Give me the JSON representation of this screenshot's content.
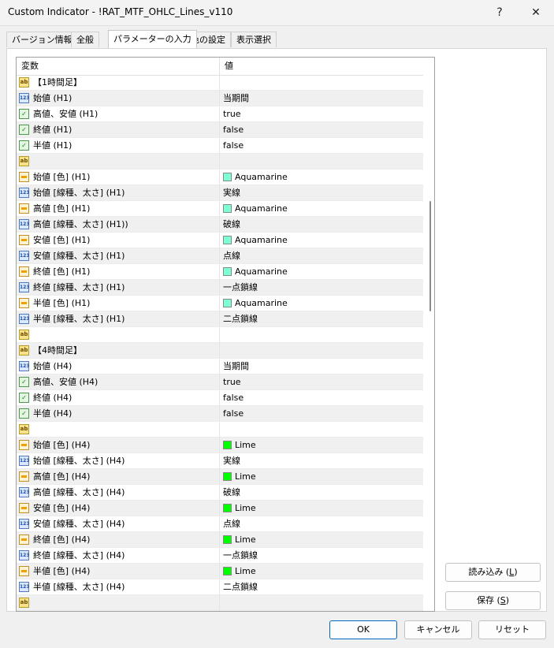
{
  "window": {
    "title": "Custom Indicator - !RAT_MTF_OHLC_Lines_v110",
    "help_glyph": "?",
    "close_glyph": "✕"
  },
  "tabs": [
    {
      "label": "バージョン情報",
      "active": false
    },
    {
      "label": "全般",
      "active": false
    },
    {
      "label": "パラメーターの入力",
      "active": true
    },
    {
      "label": "色の設定",
      "active": false
    },
    {
      "label": "表示選択",
      "active": false
    }
  ],
  "grid": {
    "col_variable": "変数",
    "col_value": "値"
  },
  "rows": [
    {
      "icon": "ab",
      "name": "【1時間足】",
      "value": ""
    },
    {
      "icon": "num",
      "name": "始値 (H1)",
      "value": "当期間"
    },
    {
      "icon": "bool",
      "name": "高値、安値 (H1)",
      "value": "true"
    },
    {
      "icon": "bool",
      "name": "終値 (H1)",
      "value": "false"
    },
    {
      "icon": "bool",
      "name": "半値 (H1)",
      "value": "false"
    },
    {
      "icon": "ab",
      "name": "",
      "value": ""
    },
    {
      "icon": "color",
      "name": "始値 [色] (H1)",
      "value": "Aquamarine",
      "swatch": "#7fffd4"
    },
    {
      "icon": "num",
      "name": "始値 [線種、太さ] (H1)",
      "value": "実線"
    },
    {
      "icon": "color",
      "name": "高値 [色] (H1)",
      "value": "Aquamarine",
      "swatch": "#7fffd4"
    },
    {
      "icon": "num",
      "name": "高値 [線種、太さ] (H1))",
      "value": "破線"
    },
    {
      "icon": "color",
      "name": "安値 [色] (H1)",
      "value": "Aquamarine",
      "swatch": "#7fffd4"
    },
    {
      "icon": "num",
      "name": "安値 [線種、太さ] (H1)",
      "value": "点線"
    },
    {
      "icon": "color",
      "name": "終値 [色] (H1)",
      "value": "Aquamarine",
      "swatch": "#7fffd4"
    },
    {
      "icon": "num",
      "name": "終値 [線種、太さ] (H1)",
      "value": "一点鎖線"
    },
    {
      "icon": "color",
      "name": "半値 [色] (H1)",
      "value": "Aquamarine",
      "swatch": "#7fffd4"
    },
    {
      "icon": "num",
      "name": "半値 [線種、太さ] (H1)",
      "value": "二点鎖線"
    },
    {
      "icon": "ab",
      "name": "",
      "value": ""
    },
    {
      "icon": "ab",
      "name": "【4時間足】",
      "value": ""
    },
    {
      "icon": "num",
      "name": "始値 (H4)",
      "value": "当期間"
    },
    {
      "icon": "bool",
      "name": "高値、安値 (H4)",
      "value": "true"
    },
    {
      "icon": "bool",
      "name": "終値 (H4)",
      "value": "false"
    },
    {
      "icon": "bool",
      "name": "半値 (H4)",
      "value": "false"
    },
    {
      "icon": "ab",
      "name": "",
      "value": ""
    },
    {
      "icon": "color",
      "name": "始値 [色] (H4)",
      "value": "Lime",
      "swatch": "#00ff00"
    },
    {
      "icon": "num",
      "name": "始値 [線種、太さ] (H4)",
      "value": "実線"
    },
    {
      "icon": "color",
      "name": "高値 [色] (H4)",
      "value": "Lime",
      "swatch": "#00ff00"
    },
    {
      "icon": "num",
      "name": "高値 [線種、太さ] (H4)",
      "value": "破線"
    },
    {
      "icon": "color",
      "name": "安値 [色] (H4)",
      "value": "Lime",
      "swatch": "#00ff00"
    },
    {
      "icon": "num",
      "name": "安値 [線種、太さ] (H4)",
      "value": "点線"
    },
    {
      "icon": "color",
      "name": "終値 [色] (H4)",
      "value": "Lime",
      "swatch": "#00ff00"
    },
    {
      "icon": "num",
      "name": "終値 [線種、太さ] (H4)",
      "value": "一点鎖線"
    },
    {
      "icon": "color",
      "name": "半値 [色] (H4)",
      "value": "Lime",
      "swatch": "#00ff00"
    },
    {
      "icon": "num",
      "name": "半値 [線種、太さ] (H4)",
      "value": "二点鎖線"
    },
    {
      "icon": "ab",
      "name": "",
      "value": ""
    },
    {
      "icon": "ab",
      "name": "",
      "value": ""
    }
  ],
  "side_buttons": {
    "load_text": "読み込み (",
    "load_key": "L",
    "save_text": "保存 (",
    "save_key": "S",
    "close_paren": ")"
  },
  "footer": {
    "ok": "OK",
    "cancel": "キャンセル",
    "reset": "リセット"
  }
}
